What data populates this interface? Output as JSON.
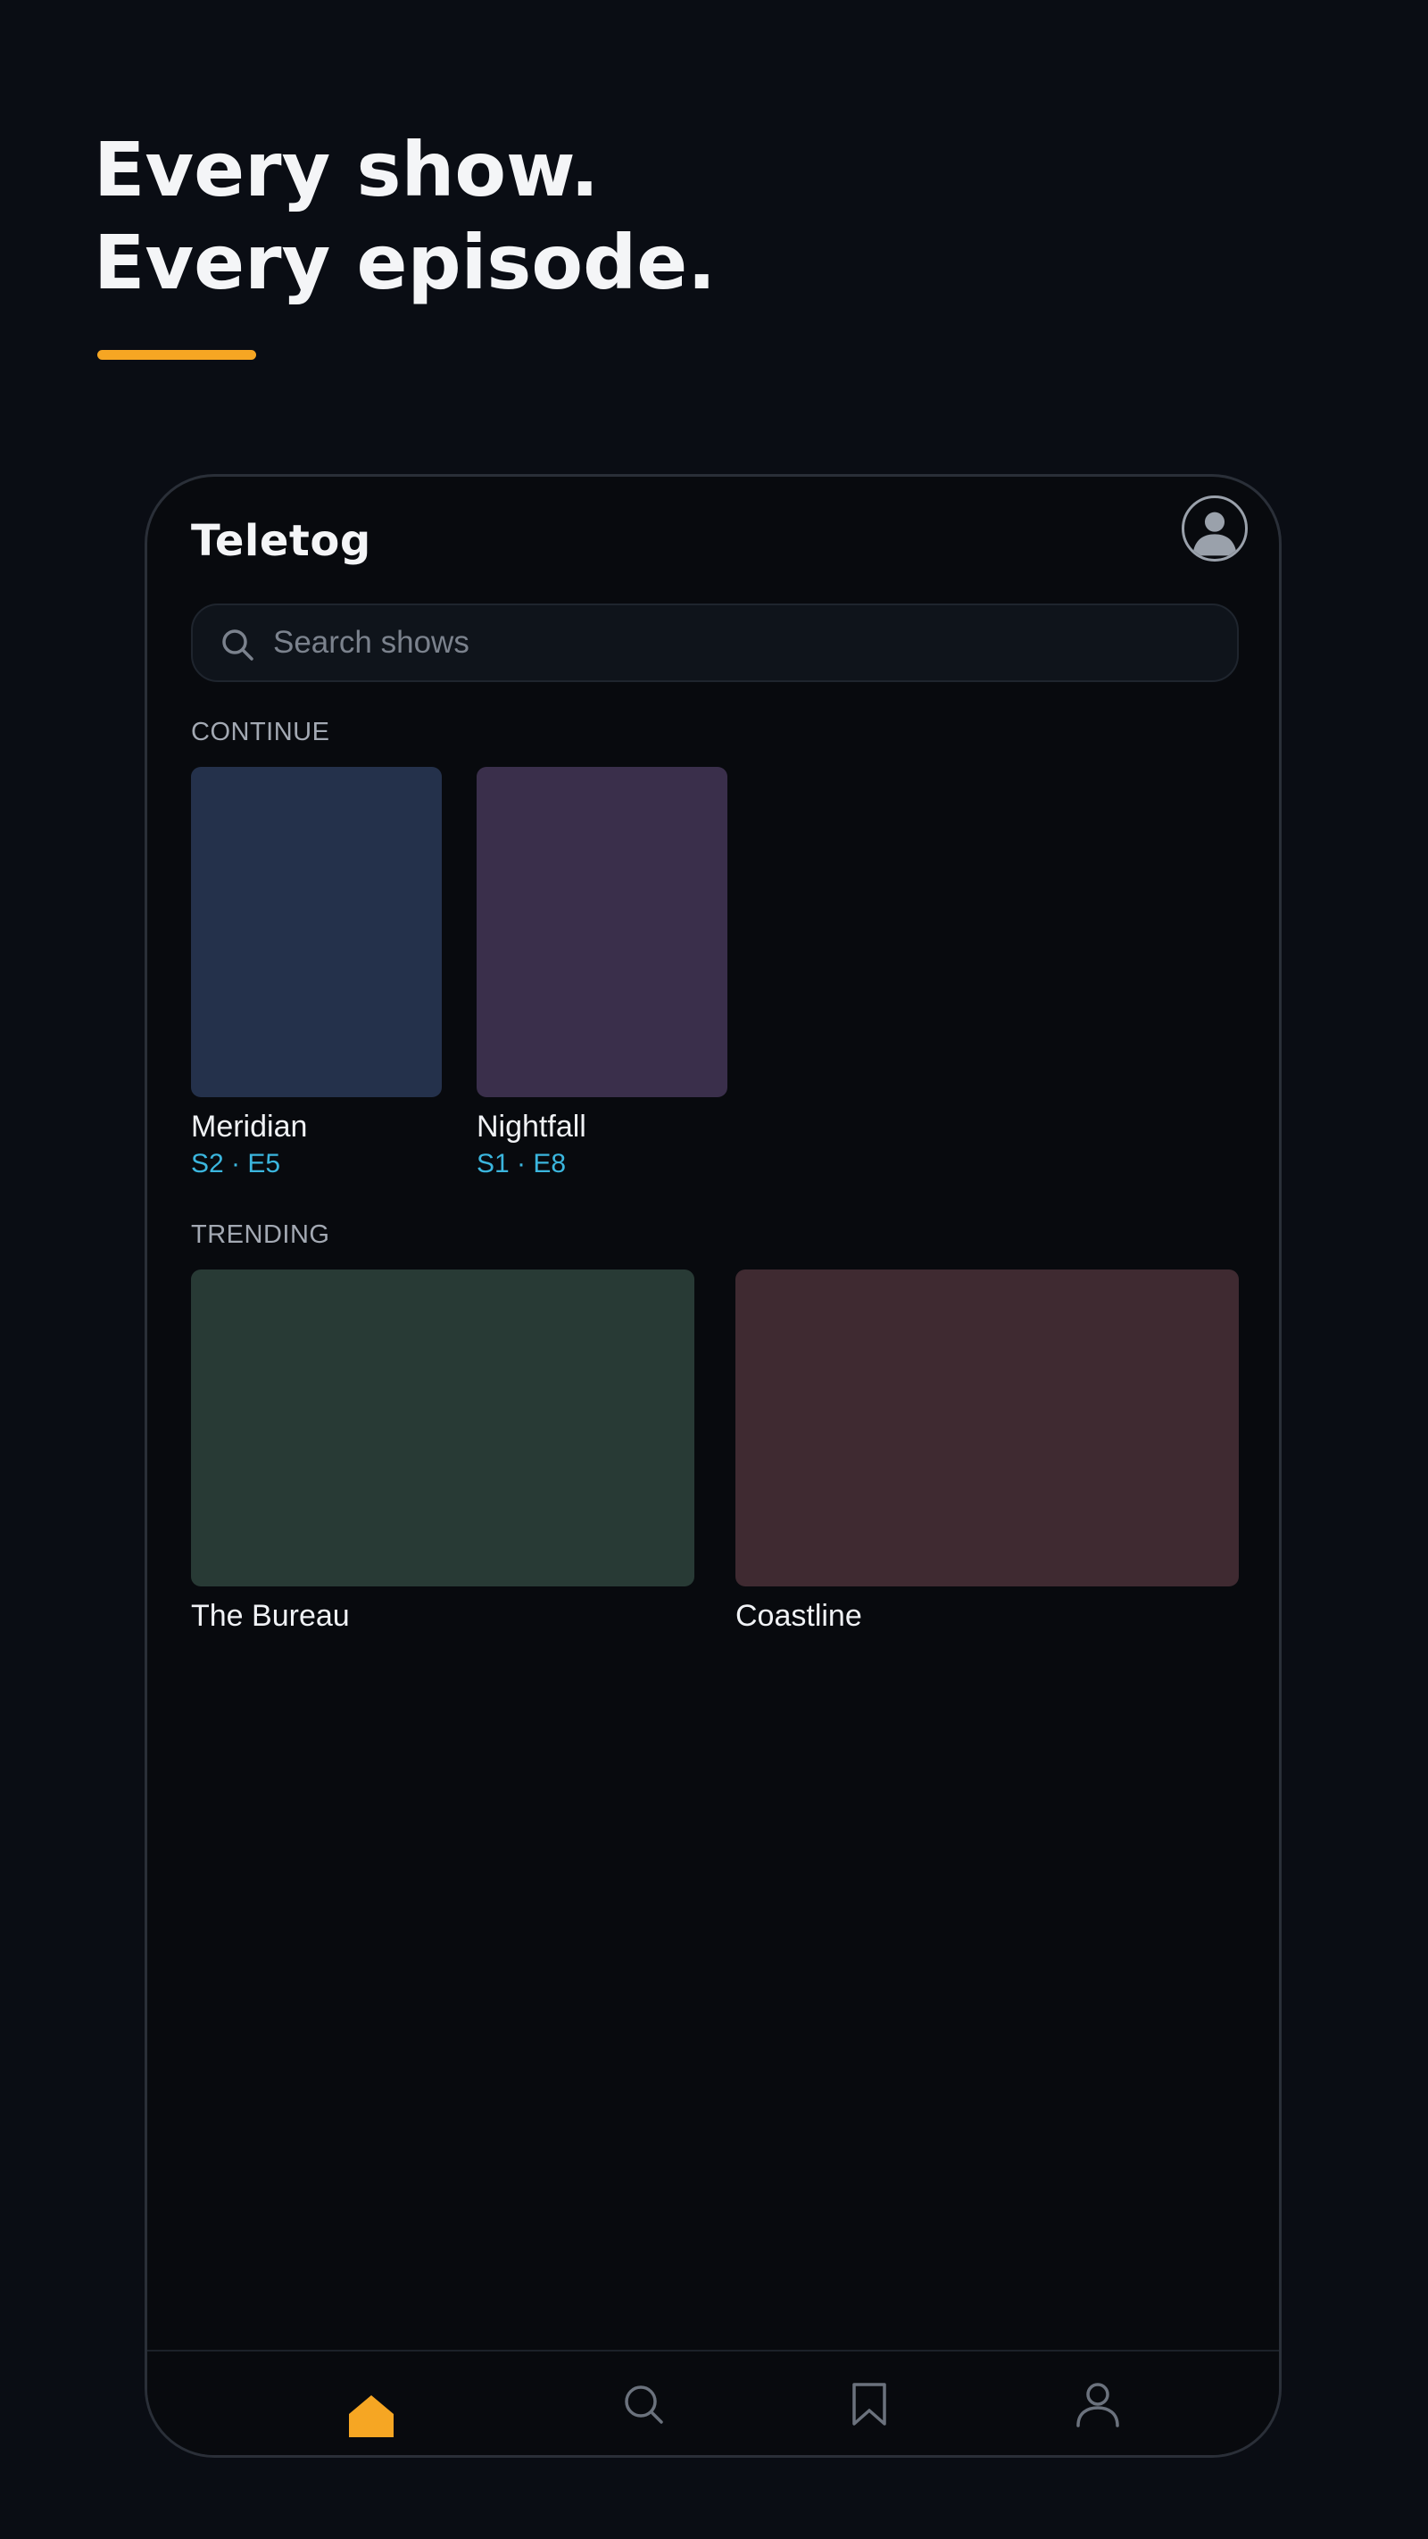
{
  "hero": {
    "line1": "Every show.",
    "line2": "Every episode.",
    "accent_color": "#f6a623"
  },
  "app": {
    "title": "Teletog",
    "avatar_icon": "user-avatar-icon"
  },
  "search": {
    "placeholder": "Search shows",
    "icon": "search-icon"
  },
  "sections": {
    "continue": {
      "label": "CONTINUE",
      "items": [
        {
          "title": "Meridian",
          "episode": "S2 · E5",
          "poster_color": "#24314b"
        },
        {
          "title": "Nightfall",
          "episode": "S1 · E8",
          "poster_color": "#3a2f4b"
        }
      ]
    },
    "trending": {
      "label": "TRENDING",
      "items": [
        {
          "title": "The Bureau",
          "poster_color": "#283a35"
        },
        {
          "title": "Coastline",
          "poster_color": "#3f2a31"
        }
      ]
    }
  },
  "bottom_nav": {
    "items": [
      {
        "id": "home",
        "icon": "home-icon",
        "active": true
      },
      {
        "id": "search",
        "icon": "search-icon",
        "active": false
      },
      {
        "id": "saved",
        "icon": "bookmark-icon",
        "active": false
      },
      {
        "id": "profile",
        "icon": "profile-icon",
        "active": false
      }
    ],
    "active_color": "#f6a623",
    "inactive_color": "#6b727d"
  },
  "colors": {
    "background": "#0a0d14",
    "episode_text": "#3bb6de"
  }
}
